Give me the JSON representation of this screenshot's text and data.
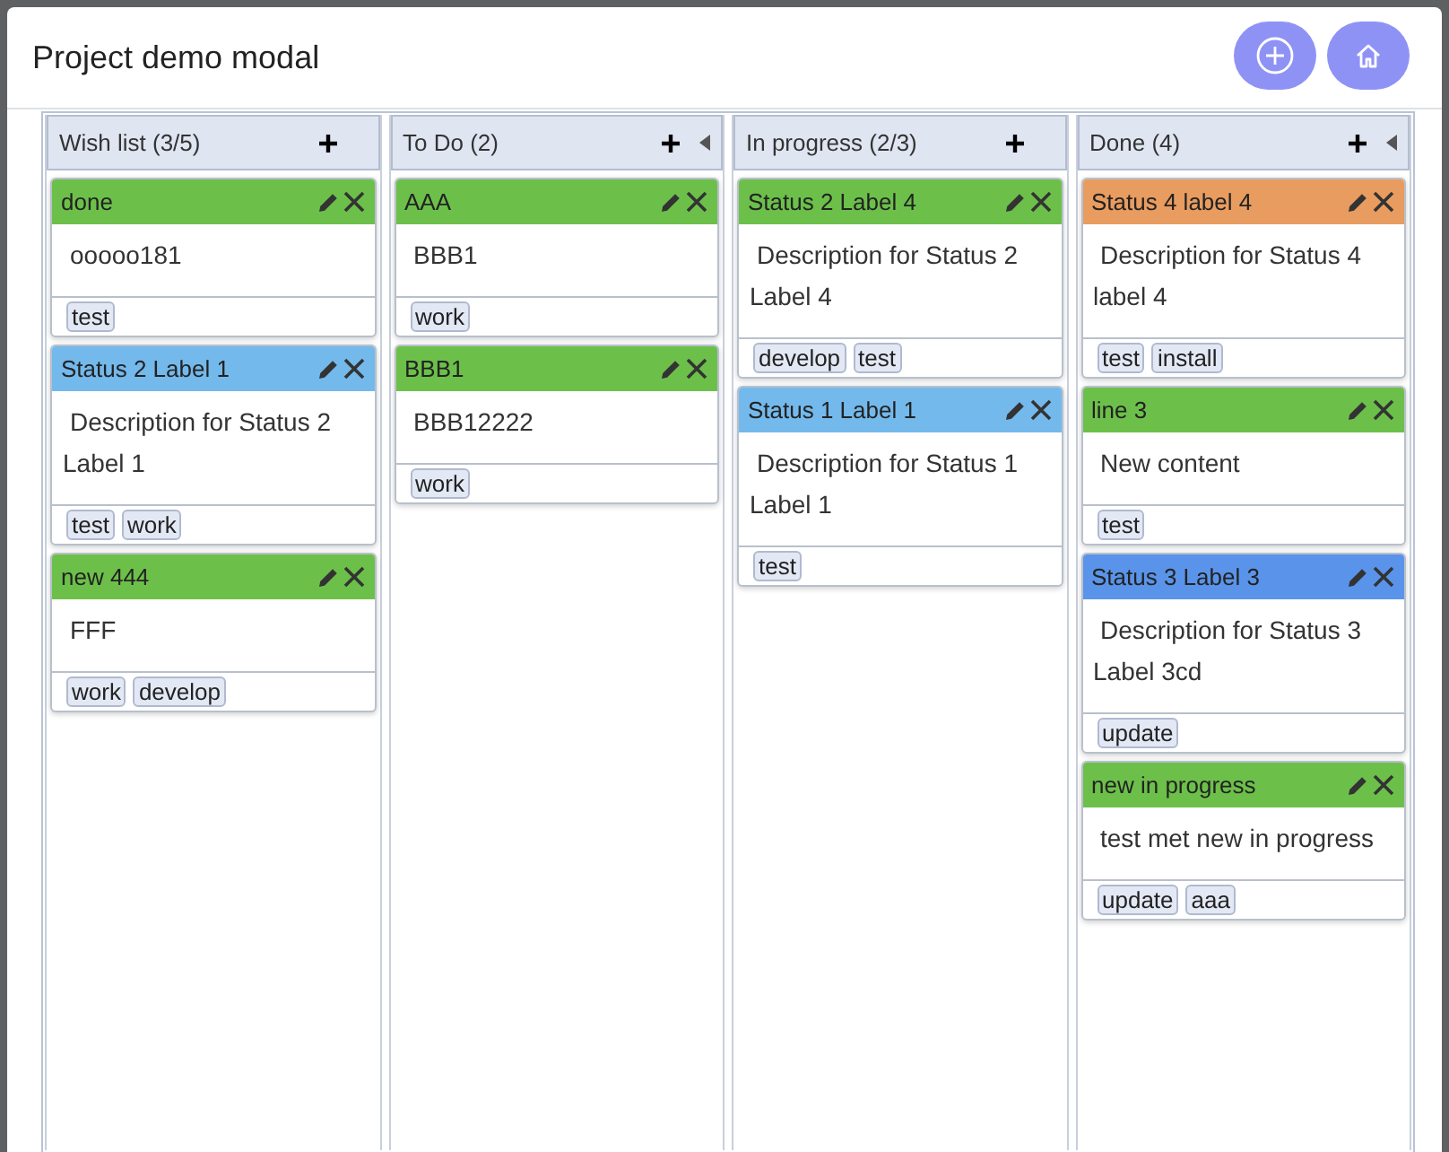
{
  "modal": {
    "title": "Project demo modal",
    "buttons": [
      {
        "kind": "add"
      },
      {
        "kind": "home"
      }
    ]
  },
  "columns": [
    {
      "title": "Wish list (3/5)",
      "collapsible": false,
      "cards": [
        {
          "title": "done",
          "color": "#6cc04a",
          "description": "ooooo181",
          "tags": [
            "test"
          ]
        },
        {
          "title": "Status 2 Label 1",
          "color": "#74b9ec",
          "description": "Description for Status 2 Label 1",
          "tags": [
            "test",
            "work"
          ]
        },
        {
          "title": "new 444",
          "color": "#6cc04a",
          "description": "FFF",
          "tags": [
            "work",
            "develop"
          ]
        }
      ]
    },
    {
      "title": "To Do (2)",
      "collapsible": true,
      "cards": [
        {
          "title": "AAA",
          "color": "#6cc04a",
          "description": "BBB1",
          "tags": [
            "work"
          ]
        },
        {
          "title": "BBB1",
          "color": "#6cc04a",
          "description": "BBB12222",
          "tags": [
            "work"
          ]
        }
      ]
    },
    {
      "title": "In progress (2/3)",
      "collapsible": false,
      "cards": [
        {
          "title": "Status 2 Label 4",
          "color": "#6cc04a",
          "description": "Description for Status 2 Label 4",
          "tags": [
            "develop",
            "test"
          ]
        },
        {
          "title": "Status 1 Label 1",
          "color": "#74b9ec",
          "description": "Description for Status 1 Label 1",
          "tags": [
            "test"
          ]
        }
      ]
    },
    {
      "title": "Done (4)",
      "collapsible": true,
      "cards": [
        {
          "title": "Status 4 label 4",
          "color": "#e99c5f",
          "description": "Description for Status 4 label 4",
          "tags": [
            "test",
            "install"
          ]
        },
        {
          "title": "line 3",
          "color": "#6cc04a",
          "description": "New content",
          "tags": [
            "test"
          ]
        },
        {
          "title": "Status 3 Label 3",
          "color": "#5a94ea",
          "description": "Description for Status 3 Label 3cd",
          "tags": [
            "update"
          ]
        },
        {
          "title": "new in progress",
          "color": "#6cc04a",
          "description": "test met new in progress",
          "tags": [
            "update",
            "aaa"
          ]
        }
      ]
    }
  ]
}
